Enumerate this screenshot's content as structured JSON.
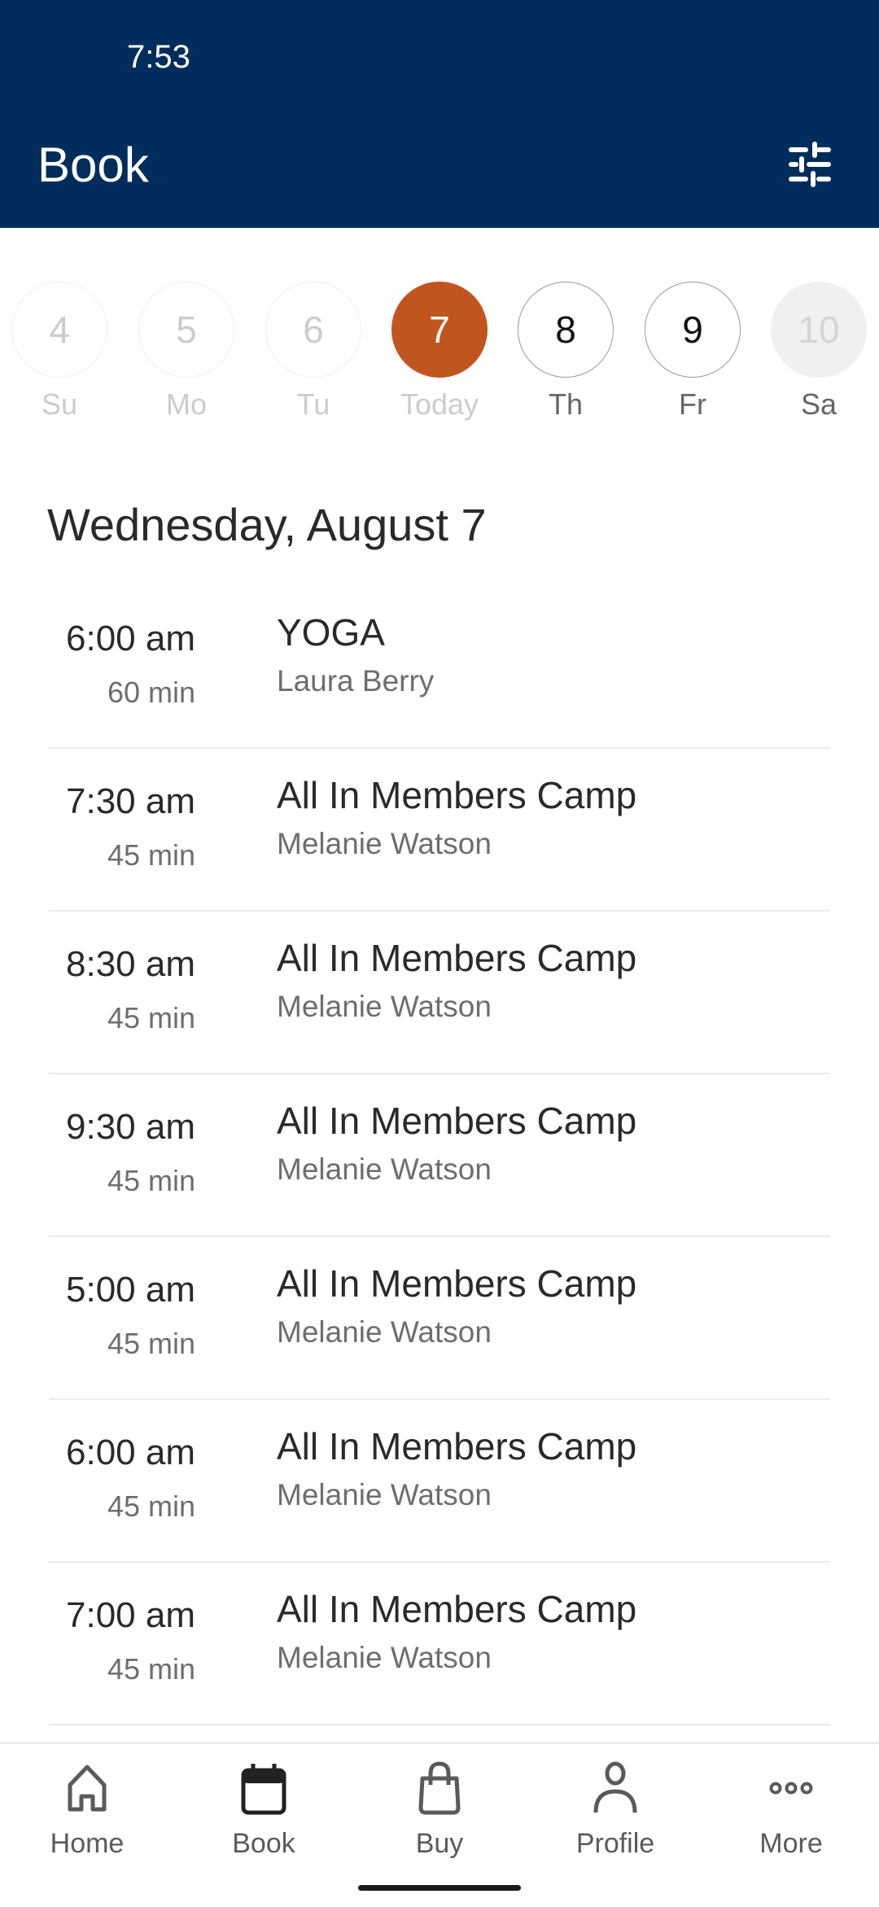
{
  "status_bar": {
    "time": "7:53"
  },
  "header": {
    "title": "Book",
    "filter_icon": "sliders-icon"
  },
  "colors": {
    "header_bg": "#002d5c",
    "today_accent": "#c1551f"
  },
  "date_strip": [
    {
      "number": "4",
      "label": "Su",
      "state": "past"
    },
    {
      "number": "5",
      "label": "Mo",
      "state": "past"
    },
    {
      "number": "6",
      "label": "Tu",
      "state": "past"
    },
    {
      "number": "7",
      "label": "Today",
      "state": "today"
    },
    {
      "number": "8",
      "label": "Th",
      "state": "future"
    },
    {
      "number": "9",
      "label": "Fr",
      "state": "future"
    },
    {
      "number": "10",
      "label": "Sa",
      "state": "disabled"
    }
  ],
  "schedule": {
    "date_heading": "Wednesday, August 7",
    "classes": [
      {
        "time": "6:00 am",
        "duration": "60 min",
        "name": "YOGA",
        "instructor": "Laura Berry"
      },
      {
        "time": "7:30 am",
        "duration": "45 min",
        "name": "All In Members Camp",
        "instructor": "Melanie Watson"
      },
      {
        "time": "8:30 am",
        "duration": "45 min",
        "name": "All In Members Camp",
        "instructor": "Melanie Watson"
      },
      {
        "time": "9:30 am",
        "duration": "45 min",
        "name": "All In Members Camp",
        "instructor": "Melanie Watson"
      },
      {
        "time": "5:00 am",
        "duration": "45 min",
        "name": "All In Members Camp",
        "instructor": "Melanie Watson"
      },
      {
        "time": "6:00 am",
        "duration": "45 min",
        "name": "All In Members Camp",
        "instructor": "Melanie Watson"
      },
      {
        "time": "7:00 am",
        "duration": "45 min",
        "name": "All In Members Camp",
        "instructor": "Melanie Watson"
      }
    ]
  },
  "tab_bar": {
    "items": [
      {
        "label": "Home",
        "icon": "home-icon",
        "active": false
      },
      {
        "label": "Book",
        "icon": "calendar-icon",
        "active": true
      },
      {
        "label": "Buy",
        "icon": "shopping-bag-icon",
        "active": false
      },
      {
        "label": "Profile",
        "icon": "person-icon",
        "active": false
      },
      {
        "label": "More",
        "icon": "more-icon",
        "active": false
      }
    ]
  }
}
